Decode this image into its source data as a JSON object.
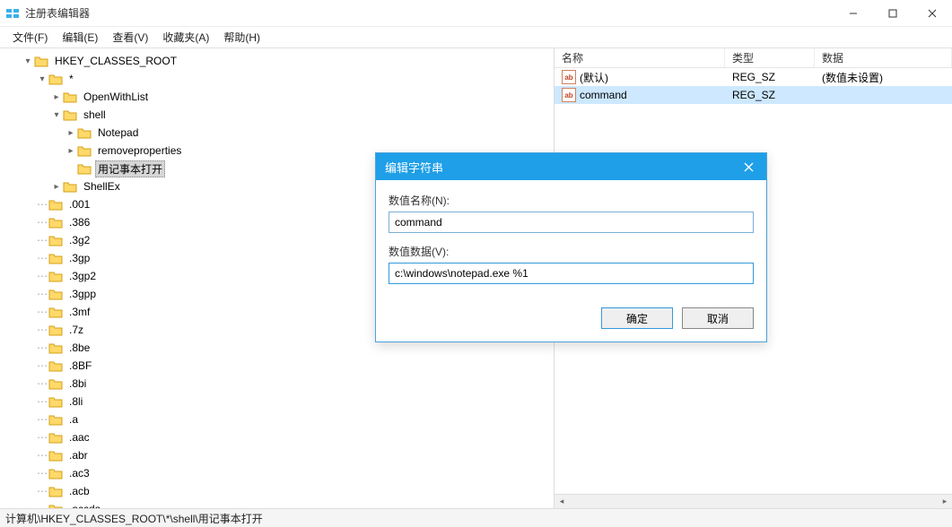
{
  "window": {
    "title": "注册表编辑器"
  },
  "menu": {
    "file": "文件(F)",
    "edit": "编辑(E)",
    "view": "查看(V)",
    "favorites": "收藏夹(A)",
    "help": "帮助(H)"
  },
  "tree": {
    "root": "HKEY_CLASSES_ROOT",
    "star": "*",
    "openwith": "OpenWithList",
    "shell": "shell",
    "notepad": "Notepad",
    "removeprops": "removeproperties",
    "opennotepad": "用记事本打开",
    "shellex": "ShellEx",
    "ext": {
      "e001": ".001",
      "e386": ".386",
      "e3g2": ".3g2",
      "e3gp": ".3gp",
      "e3gp2": ".3gp2",
      "e3gpp": ".3gpp",
      "e3mf": ".3mf",
      "e7z": ".7z",
      "e8be": ".8be",
      "e8bf": ".8BF",
      "e8bi": ".8bi",
      "e8li": ".8li",
      "ea": ".a",
      "eaac": ".aac",
      "eabr": ".abr",
      "eac3": ".ac3",
      "eacb": ".acb",
      "eaccda": ".accda"
    }
  },
  "list": {
    "headers": {
      "name": "名称",
      "type": "类型",
      "data": "数据"
    },
    "rows": [
      {
        "name": "(默认)",
        "type": "REG_SZ",
        "data": "(数值未设置)"
      },
      {
        "name": "command",
        "type": "REG_SZ",
        "data": ""
      }
    ]
  },
  "statusbar": "计算机\\HKEY_CLASSES_ROOT\\*\\shell\\用记事本打开",
  "dialog": {
    "title": "编辑字符串",
    "name_label": "数值名称(N):",
    "name_value": "command",
    "data_label": "数值数据(V):",
    "data_value": "c:\\windows\\notepad.exe %1",
    "ok": "确定",
    "cancel": "取消"
  },
  "colors": {
    "accent": "#1e9fe8",
    "selection": "#cde8ff"
  }
}
